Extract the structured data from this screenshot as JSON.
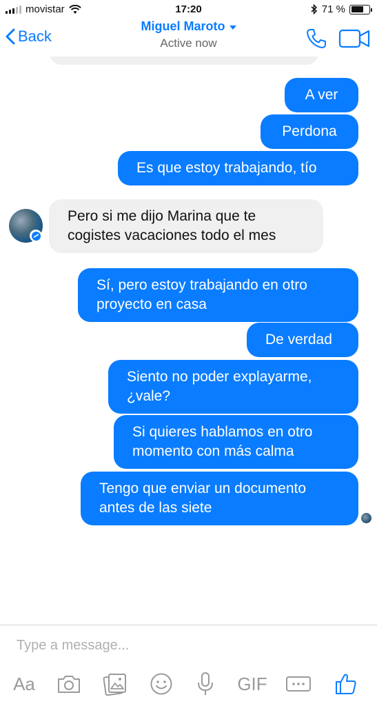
{
  "status_bar": {
    "carrier": "movistar",
    "time": "17:20",
    "battery": "71 %",
    "battery_level": 0.71
  },
  "header": {
    "back_label": "Back",
    "contact_name": "Miguel Maroto",
    "presence": "Active now"
  },
  "messages": [
    {
      "direction": "out",
      "text": "A ver"
    },
    {
      "direction": "out",
      "text": "Perdona"
    },
    {
      "direction": "out",
      "text": "Es que estoy trabajando, tío"
    },
    {
      "direction": "in",
      "text": "Pero si me dijo Marina que te cogistes vacaciones todo el mes"
    },
    {
      "direction": "out",
      "text": "Sí, pero estoy trabajando en otro proyecto en casa"
    },
    {
      "direction": "out",
      "text": "De verdad"
    },
    {
      "direction": "out",
      "text": "Siento no poder explayarme, ¿vale?"
    },
    {
      "direction": "out",
      "text": "Si quieres hablamos en otro momento con más calma"
    },
    {
      "direction": "out",
      "text": "Tengo que enviar un documento antes de las siete"
    }
  ],
  "composer": {
    "placeholder": "Type a message...",
    "tools": [
      {
        "icon": "text-format-icon",
        "label": "Aa"
      },
      {
        "icon": "camera-icon"
      },
      {
        "icon": "gallery-icon"
      },
      {
        "icon": "emoji-icon"
      },
      {
        "icon": "microphone-icon"
      },
      {
        "icon": "gif-icon",
        "label": "GIF"
      },
      {
        "icon": "more-icon"
      },
      {
        "icon": "thumbs-up-icon"
      }
    ]
  },
  "colors": {
    "accent": "#0a7cff",
    "incoming_bubble": "#f0f0f0",
    "toolbar_icon": "#9a9a9a"
  }
}
